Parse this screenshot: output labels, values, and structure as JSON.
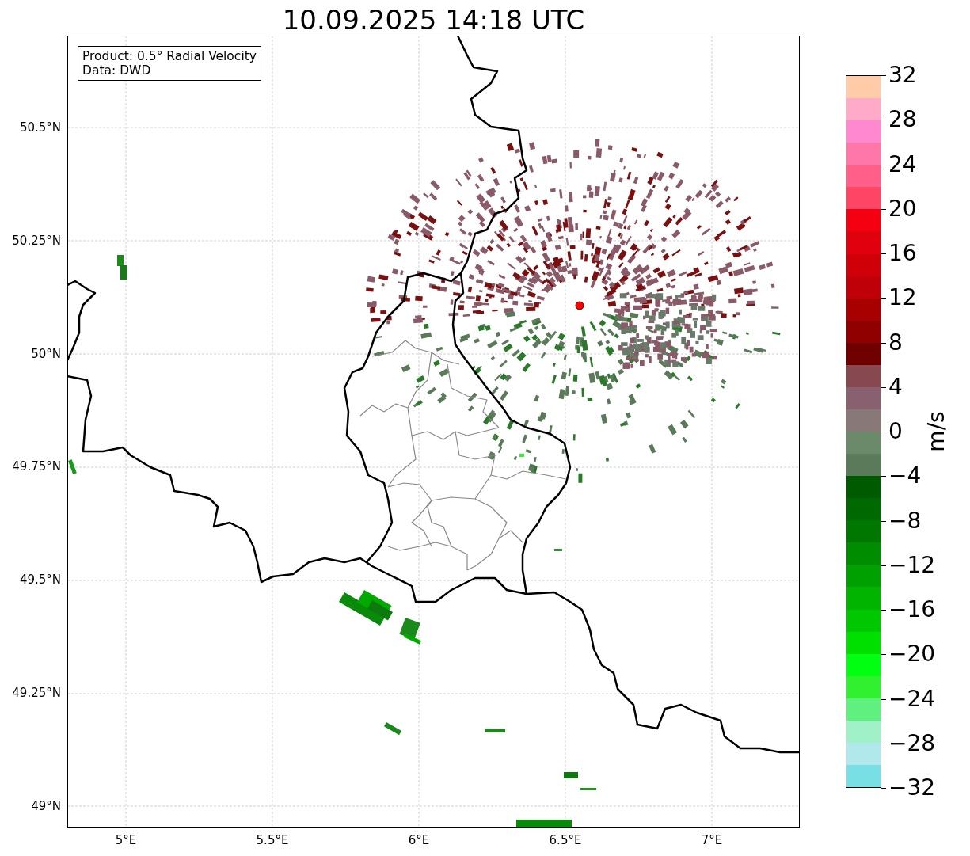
{
  "title": "10.09.2025 14:18 UTC",
  "legend": [
    "Product: 0.5° Radial Velocity",
    "Data: DWD"
  ],
  "lat_ticks": [
    "50.5°N",
    "50.25°N",
    "50°N",
    "49.75°N",
    "49.5°N",
    "49.25°N",
    "49°N"
  ],
  "lon_ticks": [
    "5°E",
    "5.5°E",
    "6°E",
    "6.5°E",
    "7°E"
  ],
  "colorbar": {
    "label": "m/s",
    "ticks": [
      "32",
      "28",
      "24",
      "20",
      "16",
      "12",
      "8",
      "4",
      "0",
      "−4",
      "−8",
      "−12",
      "−16",
      "−20",
      "−24",
      "−28",
      "−32"
    ],
    "bands": [
      {
        "color": "#ffcba8"
      },
      {
        "color": "#ffaac8"
      },
      {
        "color": "#ff88d0"
      },
      {
        "color": "#ff77a8"
      },
      {
        "color": "#ff5f88"
      },
      {
        "color": "#ff4565"
      },
      {
        "color": "#f50010"
      },
      {
        "color": "#e0000e"
      },
      {
        "color": "#d00008"
      },
      {
        "color": "#c00008"
      },
      {
        "color": "#a80000"
      },
      {
        "color": "#900000"
      },
      {
        "color": "#700000"
      },
      {
        "color": "#884850"
      },
      {
        "color": "#886070"
      },
      {
        "color": "#887878"
      },
      {
        "color": "#6a8a6a"
      },
      {
        "color": "#5a7a5a"
      },
      {
        "color": "#005a00"
      },
      {
        "color": "#006800"
      },
      {
        "color": "#007800"
      },
      {
        "color": "#008c00"
      },
      {
        "color": "#00a000"
      },
      {
        "color": "#00b400"
      },
      {
        "color": "#00c800"
      },
      {
        "color": "#00e000"
      },
      {
        "color": "#00ff10"
      },
      {
        "color": "#30f030"
      },
      {
        "color": "#60f080"
      },
      {
        "color": "#a0f0c8"
      },
      {
        "color": "#b0e8ec"
      },
      {
        "color": "#78e0e4"
      }
    ]
  }
}
